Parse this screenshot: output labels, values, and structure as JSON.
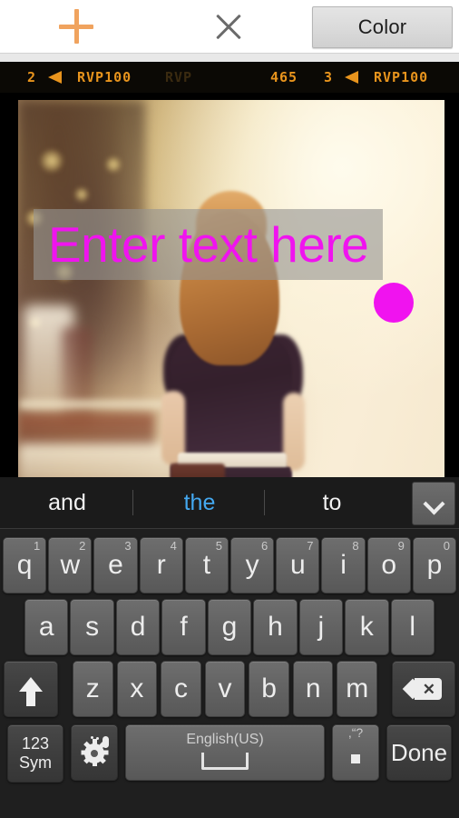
{
  "toolbar": {
    "add_label": "+",
    "add_icon": "plus-icon",
    "close_label": "×",
    "close_icon": "close-icon",
    "color_button_label": "Color",
    "accent_plus_color": "#f0a35e",
    "close_color": "#6b6b6b"
  },
  "filmstrip": {
    "left_frame_number": "2",
    "left_film_name": "RVP100",
    "ghost_text": "RVP",
    "center_code": "465",
    "right_frame_number": "3",
    "right_film_name": "RVP100",
    "text_color": "#e8941d",
    "background_color": "#0b0905"
  },
  "canvas": {
    "text_overlay_value": "Enter text here",
    "text_overlay_placeholder": "Enter text here",
    "text_color": "#f013ef",
    "selection_box_color": "#969492",
    "color_swatch_color": "#f013ef",
    "resize_handle_icon": "resize-handle-icon"
  },
  "keyboard": {
    "suggestions": [
      {
        "label": "and",
        "active": false
      },
      {
        "label": "the",
        "active": true
      },
      {
        "label": "to",
        "active": false
      }
    ],
    "active_suggestion_color": "#44a8f0",
    "expand_icon": "chevron-down-icon",
    "row1": [
      {
        "key": "q",
        "hint": "1"
      },
      {
        "key": "w",
        "hint": "2"
      },
      {
        "key": "e",
        "hint": "3"
      },
      {
        "key": "r",
        "hint": "4"
      },
      {
        "key": "t",
        "hint": "5"
      },
      {
        "key": "y",
        "hint": "6"
      },
      {
        "key": "u",
        "hint": "7"
      },
      {
        "key": "i",
        "hint": "8"
      },
      {
        "key": "o",
        "hint": "9"
      },
      {
        "key": "p",
        "hint": "0"
      }
    ],
    "row2": [
      {
        "key": "a"
      },
      {
        "key": "s"
      },
      {
        "key": "d"
      },
      {
        "key": "f"
      },
      {
        "key": "g"
      },
      {
        "key": "h"
      },
      {
        "key": "j"
      },
      {
        "key": "k"
      },
      {
        "key": "l"
      }
    ],
    "row3": [
      {
        "key": "z"
      },
      {
        "key": "x"
      },
      {
        "key": "c"
      },
      {
        "key": "v"
      },
      {
        "key": "b"
      },
      {
        "key": "n"
      },
      {
        "key": "m"
      }
    ],
    "shift_icon": "shift-arrow-up-icon",
    "backspace_icon": "backspace-icon",
    "sym_label_line1": "123",
    "sym_label_line2": "Sym",
    "settings_icon": "gear-with-mic-icon",
    "space_label": "English(US)",
    "space_icon": "spacebar-icon",
    "period_key": ".",
    "period_hint": ",“?",
    "done_label": "Done"
  }
}
